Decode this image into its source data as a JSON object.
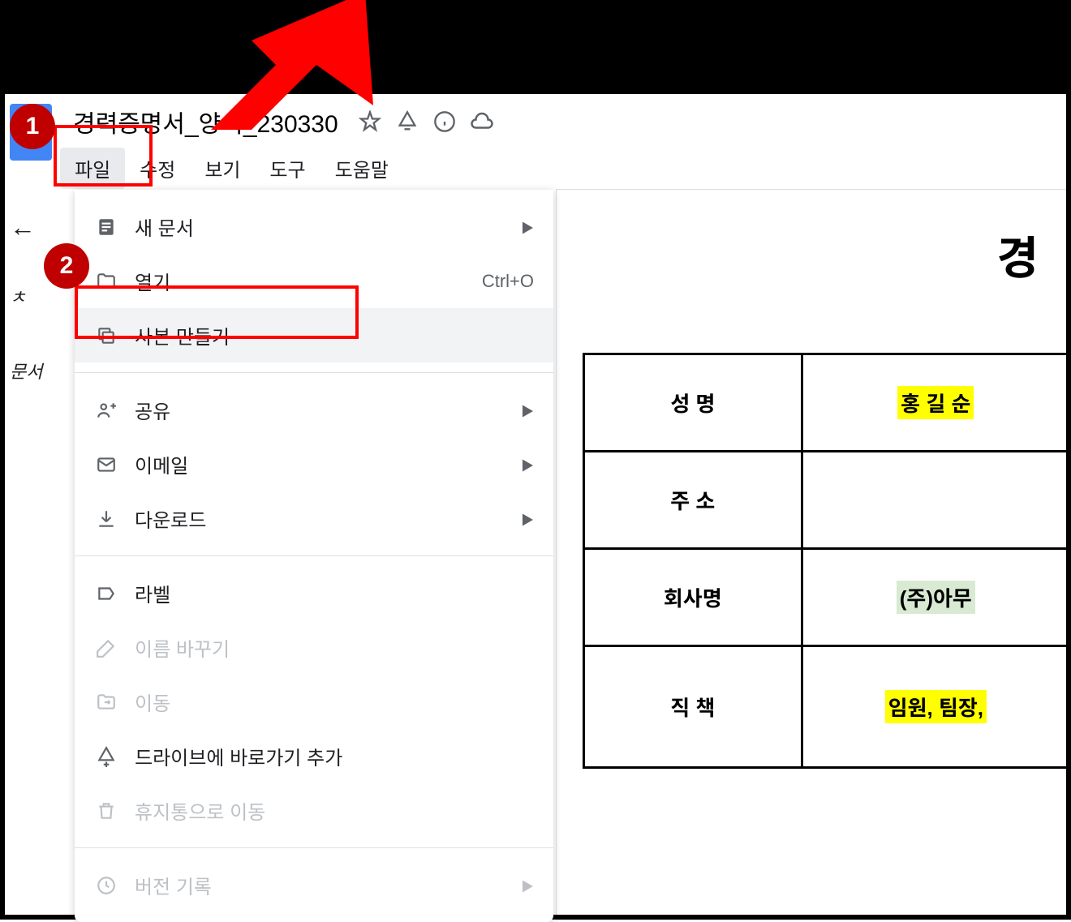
{
  "header": {
    "doc_title": "경력증명서_양식_230330"
  },
  "menu_bar": {
    "file": "파일",
    "edit": "수정",
    "view": "보기",
    "tools": "도구",
    "help": "도움말"
  },
  "file_menu": {
    "new_doc": "새 문서",
    "open": "열기",
    "open_shortcut": "Ctrl+O",
    "make_copy": "사본 만들기",
    "share": "공유",
    "email": "이메일",
    "download": "다운로드",
    "labels": "라벨",
    "rename": "이름 바꾸기",
    "move": "이동",
    "add_shortcut": "드라이브에 바로가기 추가",
    "move_to_trash": "휴지통으로 이동",
    "version_history": "버전 기록"
  },
  "side": {
    "char1": "ㅊ",
    "doc_label": "문서"
  },
  "document": {
    "heading": "경",
    "rows": {
      "name_label": "성 명",
      "name_value": "홍 길 순",
      "address_label": "주 소",
      "address_value": "",
      "company_label": "회사명",
      "company_value": "(주)아무",
      "position_label": "직 책",
      "position_value": "임원, 팀장,"
    }
  },
  "callouts": {
    "badge1": "1",
    "badge2": "2"
  }
}
